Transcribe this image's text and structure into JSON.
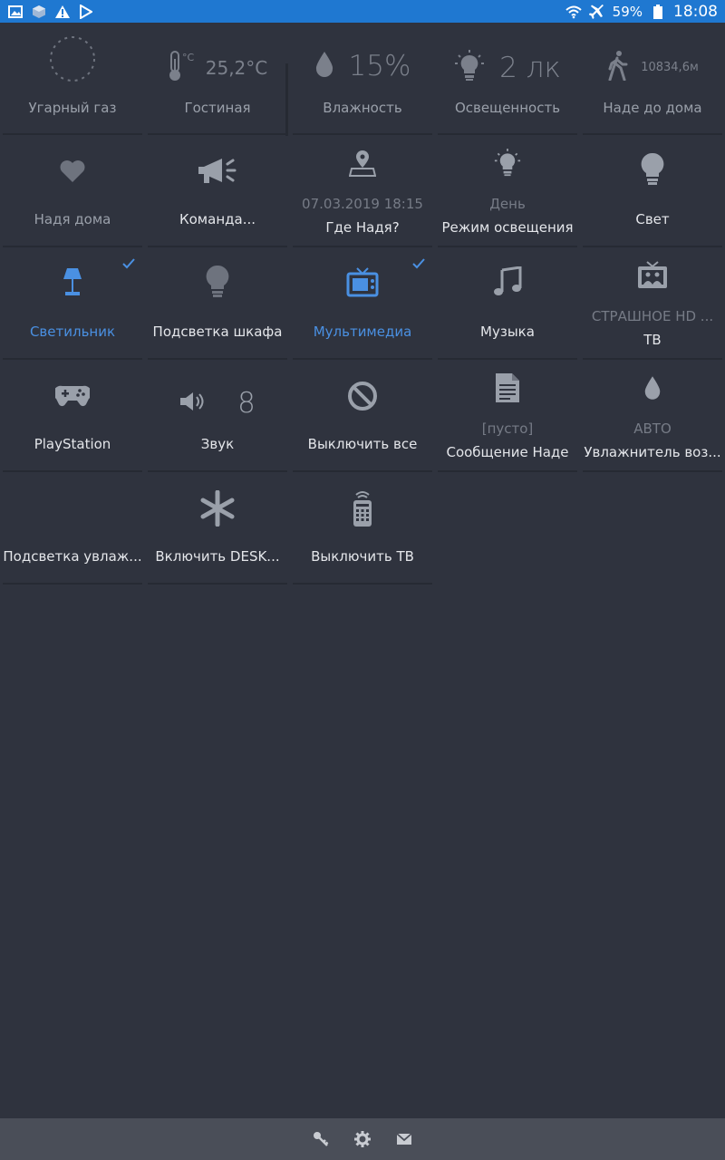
{
  "status_bar": {
    "battery_percent": "59%",
    "time": "18:08"
  },
  "tiles": [
    {
      "label": "Угарный газ"
    },
    {
      "label": "Гостиная",
      "value": "25,2°C"
    },
    {
      "label": "Влажность",
      "value": "15%"
    },
    {
      "label": "Освещенность",
      "value": "2 лк"
    },
    {
      "label": "Наде до дома",
      "value": "10834,6м"
    },
    {
      "label": "Надя дома"
    },
    {
      "label": "Команда..."
    },
    {
      "label": "Где Надя?",
      "sub": "07.03.2019 18:15"
    },
    {
      "label": "Режим освещения",
      "sub": "День"
    },
    {
      "label": "Свет"
    },
    {
      "label": "Светильник"
    },
    {
      "label": "Подсветка шкафа"
    },
    {
      "label": "Мультимедиа"
    },
    {
      "label": "Музыка"
    },
    {
      "label": "ТВ",
      "sub": "СТРАШНОЕ HD ..."
    },
    {
      "label": "PlayStation"
    },
    {
      "label": "Звук",
      "value": "8"
    },
    {
      "label": "Выключить все"
    },
    {
      "label": "Сообщение Наде",
      "sub": "[пусто]"
    },
    {
      "label": "Увлажнитель воз...",
      "sub": "АВТО"
    },
    {
      "label": "Подсветка увлаж..."
    },
    {
      "label": "Включить DESK..."
    },
    {
      "label": "Выключить ТВ"
    }
  ],
  "colors": {
    "background": "#2f333e",
    "status_bar": "#1f78d1",
    "accent": "#4a90e2",
    "bottom_bar": "#4a4e58"
  },
  "icons": {
    "status_bar": [
      "image-icon",
      "cube-icon",
      "warning-icon",
      "play-store-icon",
      "wifi-icon",
      "airplane-icon",
      "battery-icon"
    ],
    "bottom_bar": [
      "key-icon",
      "gear-icon",
      "mail-icon"
    ]
  }
}
